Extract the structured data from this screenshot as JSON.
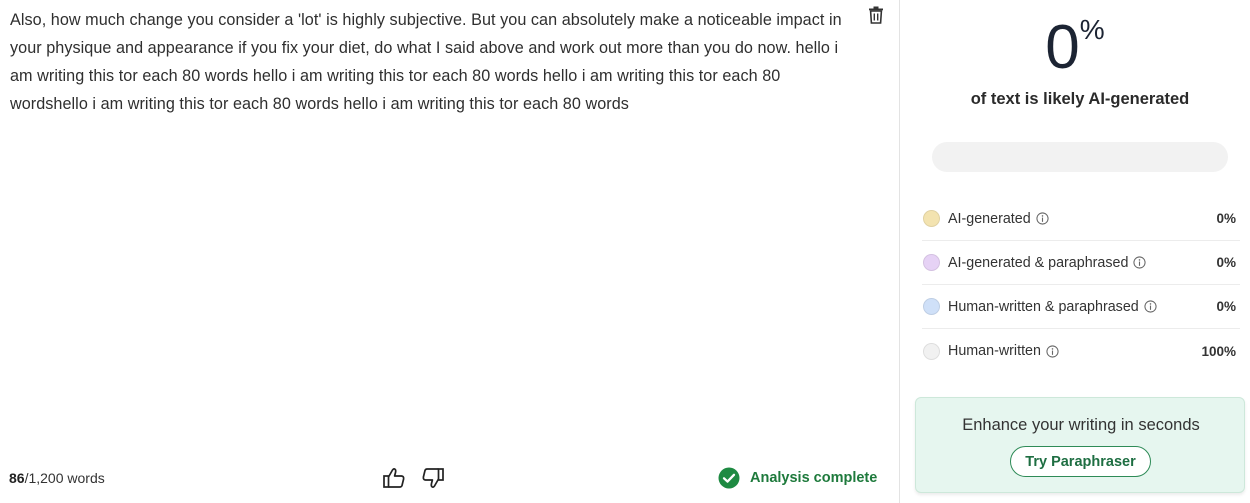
{
  "editor": {
    "text_paragraph": "Also, how much change you consider a 'lot' is highly subjective. But you can absolutely make a noticeable impact in your physique and appearance if you fix your diet, do what I said above and work out more than you do now. hello i am writing this tor each 80 words hello i am writing this tor each 80 words hello i am writing this tor each 80 wordshello i am writing this tor each 80 words hello i am writing this tor each 80 words",
    "delete_icon": "trash-icon"
  },
  "footer": {
    "word_count_current": "86",
    "word_count_limit": "/1,200 words",
    "thumbs_up_icon": "thumbs-up-icon",
    "thumbs_down_icon": "thumbs-down-icon",
    "status_text": "Analysis complete",
    "status_color": "#1e7a3c"
  },
  "results": {
    "score_value": "0",
    "score_unit": "%",
    "score_caption": "of text is likely AI-generated",
    "progress_fraction": 0,
    "legend": [
      {
        "label": "AI-generated",
        "value": "0%",
        "color": "#f3e3b0"
      },
      {
        "label": "AI-generated & paraphrased",
        "value": "0%",
        "color": "#e6d2f5"
      },
      {
        "label": "Human-written & paraphrased",
        "value": "0%",
        "color": "#cfe0f8"
      },
      {
        "label": "Human-written",
        "value": "100%",
        "color": "#f1f1f1"
      }
    ]
  },
  "promo": {
    "title": "Enhance your writing in seconds",
    "button_label": "Try Paraphraser",
    "accent": "#2e8b57",
    "background": "#e6f6ef"
  }
}
